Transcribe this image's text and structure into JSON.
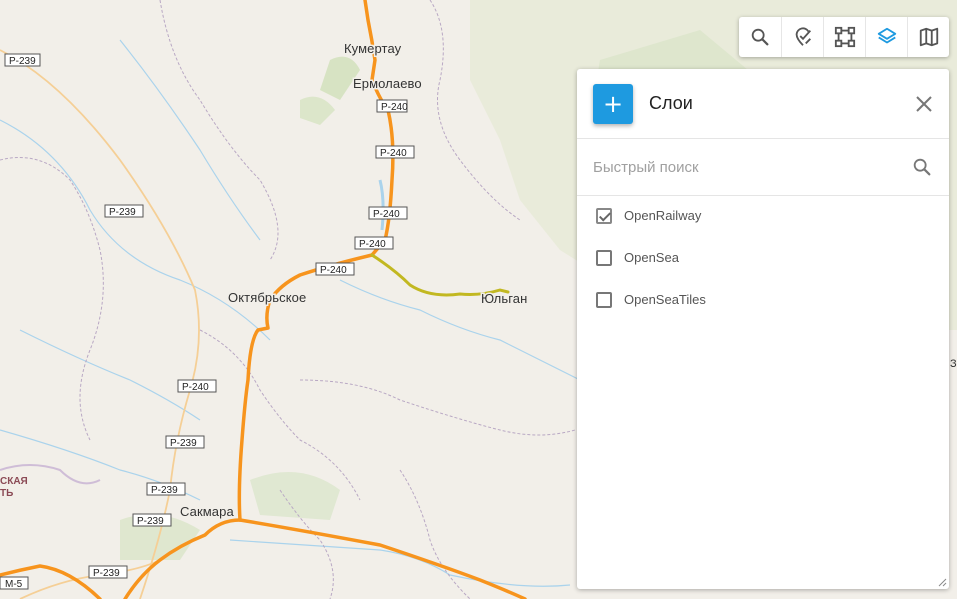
{
  "map": {
    "towns": [
      "Кумертау",
      "Ермолаево",
      "Октябрьское",
      "Юльган",
      "Сакмара"
    ],
    "region_label": [
      "СКАЯ",
      "ТЬ"
    ],
    "shields": [
      "Р-239",
      "Р-240",
      "Р-240",
      "Р-240",
      "Р-240",
      "Р-240",
      "Р-239",
      "Р-240",
      "Р-239",
      "Р-239",
      "Р-239",
      "Р-239",
      "М-5"
    ],
    "edge_char": "З",
    "colors": {
      "railway": "#f7941d",
      "secondary_line": "#c2b821",
      "panel_accent": "#1e9ae0",
      "background": "#f2efe9"
    }
  },
  "toolbar": {
    "buttons": [
      {
        "name": "search",
        "icon": "search-icon"
      },
      {
        "name": "measure",
        "icon": "ruler-pin-icon"
      },
      {
        "name": "select-area",
        "icon": "bounding-box-icon"
      },
      {
        "name": "layers",
        "icon": "layers-icon",
        "active": true
      },
      {
        "name": "basemap",
        "icon": "map-icon"
      }
    ]
  },
  "panel": {
    "add_label": "+",
    "title": "Слои",
    "search_placeholder": "Быстрый поиск",
    "search_value": "",
    "layers": [
      {
        "label": "OpenRailway",
        "checked": true
      },
      {
        "label": "OpenSea",
        "checked": false
      },
      {
        "label": "OpenSeaTiles",
        "checked": false
      }
    ]
  }
}
